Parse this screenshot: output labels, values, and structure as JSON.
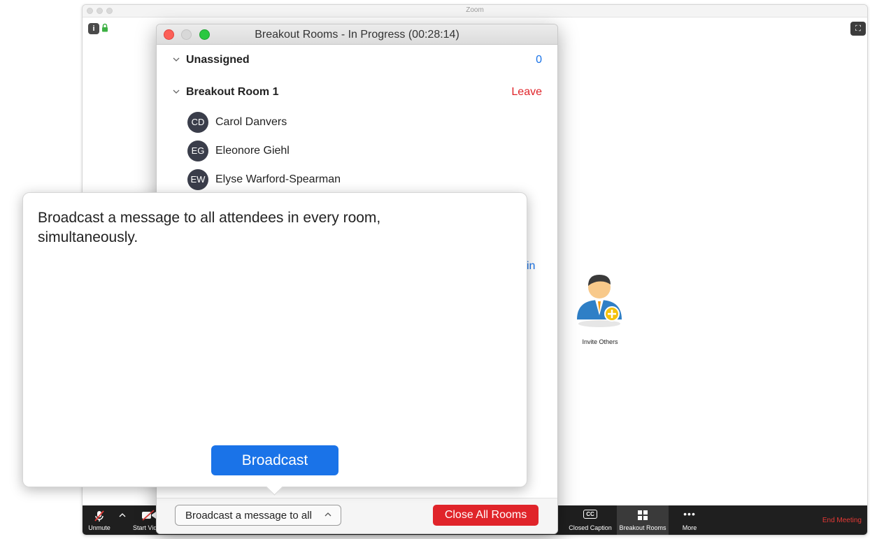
{
  "zoom_window": {
    "title": "Zoom"
  },
  "invite": {
    "label": "Invite Others"
  },
  "toolbar": {
    "unmute": "Unmute",
    "start_video": "Start Vid",
    "closed_caption": "Closed Caption",
    "cc_glyph": "CC",
    "breakout_rooms": "Breakout Rooms",
    "more": "More",
    "end_meeting": "End Meeting"
  },
  "breakout_window": {
    "title": "Breakout Rooms - In Progress (00:28:14)",
    "unassigned": {
      "label": "Unassigned",
      "count": "0"
    },
    "room1": {
      "label": "Breakout Room 1",
      "action": "Leave",
      "members": [
        {
          "initials": "CD",
          "name": "Carol Danvers"
        },
        {
          "initials": "EG",
          "name": "Eleonore Giehl"
        },
        {
          "initials": "EW",
          "name": "Elyse Warford-Spearman"
        }
      ]
    },
    "join_fragment": "in",
    "footer": {
      "broadcast_select": "Broadcast a message to all",
      "close_all": "Close All Rooms"
    }
  },
  "popover": {
    "message": "Broadcast a message to all attendees in every room, simultaneously.",
    "button": "Broadcast"
  },
  "colors": {
    "accent_blue": "#1a73e8",
    "danger_red": "#e0242a",
    "toolbar_bg": "#1f1f1f"
  }
}
